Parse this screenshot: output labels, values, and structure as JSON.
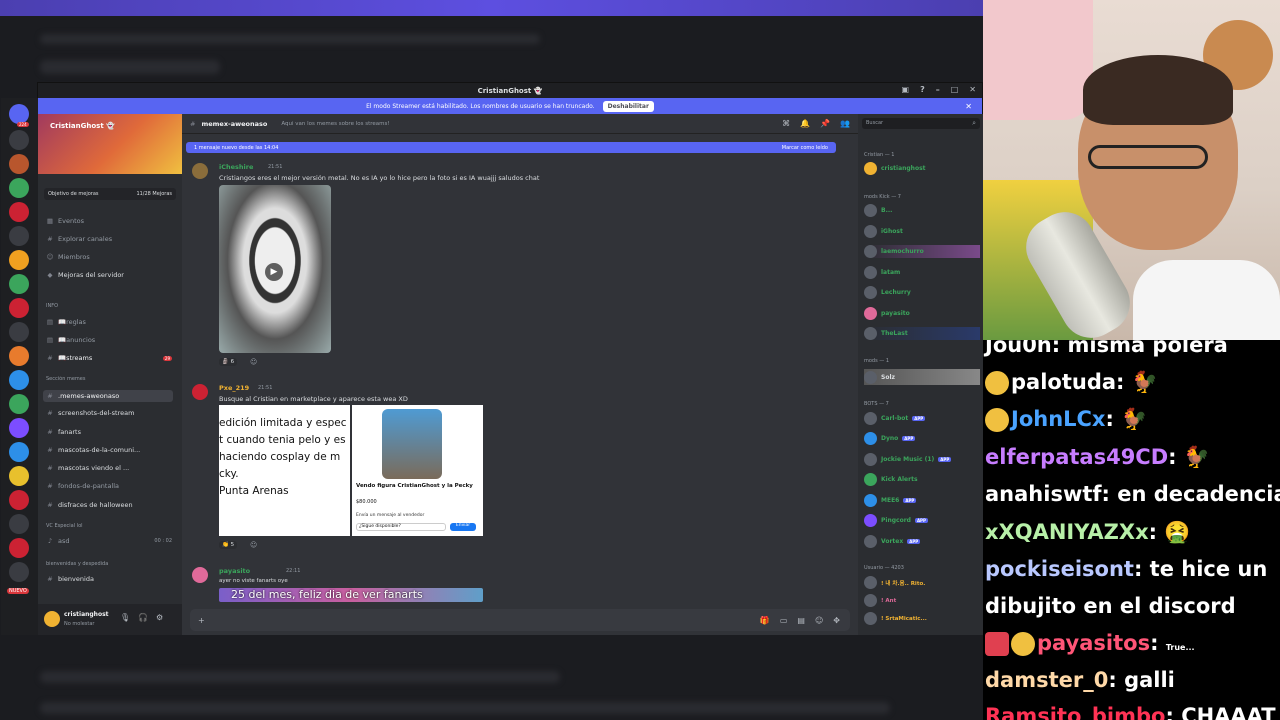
{
  "app": {
    "title": "CristianGhost 👻"
  },
  "banner": {
    "text": "El modo Streamer está habilitado. Los nombres de usuario se han truncado.",
    "button": "Deshabilitar"
  },
  "rail": {
    "badges": [
      "224",
      "NUEVO"
    ]
  },
  "server": {
    "name": "CristianGhost 👻",
    "boost_label": "Objetivo de mejoras",
    "boost_value": "11/28 Mejoras",
    "nav": [
      "Eventos",
      "Explorar canales",
      "Miembros",
      "Mejoras del servidor"
    ],
    "categories": [
      {
        "label": "INFO"
      },
      {
        "label": "Sección memes"
      },
      {
        "label": "VC Especial lol"
      },
      {
        "label": "bienvenidas y despedida"
      }
    ],
    "channels_info": [
      "📖reglas",
      "📖anuncios",
      "📖streams"
    ],
    "streams_badge": "29",
    "channels_memes": [
      ".memes-aweonaso",
      "screenshots-del-stream",
      "fanarts",
      "mascotas-de-la-comuni...",
      "mascotas viendo el ...",
      "fondos-de-pantalla",
      "disfraces de halloween"
    ],
    "vc_channel": "asd",
    "vc_counts": "00 : 02",
    "welcome_channel": "bienvenida"
  },
  "user": {
    "name": "cristianghost",
    "status": "No molestar"
  },
  "channel": {
    "name": "memex-aweonaso",
    "topic": "Aqui van los memes sobre los streams!"
  },
  "search": {
    "placeholder": "Buscar"
  },
  "newbar": {
    "left": "1 mensaje nuevo desde las 14:04",
    "right": "Marcar como leído"
  },
  "messages": [
    {
      "author": "iCheshire",
      "time": "21:51",
      "text": "Cristiangos eres el mejor versión metal. No es IA yo lo hice pero la foto si es IA wuajjj saludos chat",
      "reaction": "6"
    },
    {
      "author": "Pxe_219",
      "time": "21:51",
      "text": "Busque al Cristian en marketplace y aparece esta wea XD",
      "reaction": "5",
      "card_lines": [
        "edición limitada y espec",
        "t cuando tenia pelo y es",
        "haciendo cosplay de m",
        "cky.",
        "Punta Arenas"
      ],
      "card_title": "Vendo figura CristianGhost y la Pecky",
      "card_price": "$80.000",
      "card_note": "Envía un mensaje al vendedor",
      "card_input": "¿Sigue disponible?",
      "card_send": "Enviar"
    },
    {
      "author": "payasito",
      "time": "22:11",
      "text": "ayer no viste fanarts oye",
      "subtitle": "25 del mes, feliz dia de ver fanarts"
    }
  ],
  "members": {
    "groups": [
      {
        "label": "Cristian — 1",
        "users": [
          "cristianghost"
        ]
      },
      {
        "label": "mods Kick — 7",
        "users": [
          "B...",
          "iGhost",
          "laemochurro",
          "latam",
          "Lechurry",
          "payasito",
          "TheLast"
        ]
      },
      {
        "label": "mods — 1",
        "users": [
          "Solz"
        ]
      },
      {
        "label": "BOTS — 7",
        "users": [
          "Carl-bot",
          "Dyno",
          "Jockie Music (1)",
          "Kick Alerts",
          "MEE6",
          "Pingcord",
          "Vortex"
        ]
      },
      {
        "label": "Usuario — 4203",
        "users": [
          "! 내 차.음.. Rito.",
          "! Ant",
          "! SrtaMicatic..."
        ]
      }
    ],
    "app_tag": "APP"
  },
  "stream_chat": [
    {
      "user": "Jou0h",
      "color": "#ffffff",
      "text": "misma polera"
    },
    {
      "user": "palotuda",
      "color": "#ffffff",
      "text": "🐓"
    },
    {
      "user": "JohnLCx",
      "color": "#4aa3ff",
      "text": "🐓"
    },
    {
      "user": "elferpatas49CD",
      "color": "#c77dff",
      "text": "🐓"
    },
    {
      "user": "anahiswtf",
      "color": "#ffffff",
      "text": "en decadencia"
    },
    {
      "user": "xXQANIYAZXx",
      "color": "#b7f0a8",
      "text": "🤮"
    },
    {
      "user": "pockiseisont",
      "color": "#b9c8ff",
      "text": "te hice un"
    },
    {
      "user": "",
      "color": "#ffffff",
      "text": "dibujito en el discord"
    },
    {
      "user": "payasitos",
      "color": "#ff5577",
      "text": "True..."
    },
    {
      "user": "damster_0",
      "color": "#ffd9a8",
      "text": "galli"
    },
    {
      "user": "Ramsito_bimbo",
      "color": "#ff3355",
      "text": "CHAAAT"
    }
  ]
}
